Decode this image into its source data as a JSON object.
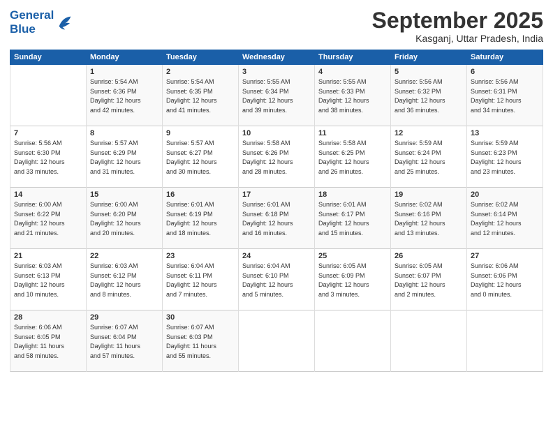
{
  "logo": {
    "line1": "General",
    "line2": "Blue"
  },
  "title": "September 2025",
  "subtitle": "Kasganj, Uttar Pradesh, India",
  "headers": [
    "Sunday",
    "Monday",
    "Tuesday",
    "Wednesday",
    "Thursday",
    "Friday",
    "Saturday"
  ],
  "weeks": [
    [
      {
        "day": "",
        "info": ""
      },
      {
        "day": "1",
        "info": "Sunrise: 5:54 AM\nSunset: 6:36 PM\nDaylight: 12 hours\nand 42 minutes."
      },
      {
        "day": "2",
        "info": "Sunrise: 5:54 AM\nSunset: 6:35 PM\nDaylight: 12 hours\nand 41 minutes."
      },
      {
        "day": "3",
        "info": "Sunrise: 5:55 AM\nSunset: 6:34 PM\nDaylight: 12 hours\nand 39 minutes."
      },
      {
        "day": "4",
        "info": "Sunrise: 5:55 AM\nSunset: 6:33 PM\nDaylight: 12 hours\nand 38 minutes."
      },
      {
        "day": "5",
        "info": "Sunrise: 5:56 AM\nSunset: 6:32 PM\nDaylight: 12 hours\nand 36 minutes."
      },
      {
        "day": "6",
        "info": "Sunrise: 5:56 AM\nSunset: 6:31 PM\nDaylight: 12 hours\nand 34 minutes."
      }
    ],
    [
      {
        "day": "7",
        "info": "Sunrise: 5:56 AM\nSunset: 6:30 PM\nDaylight: 12 hours\nand 33 minutes."
      },
      {
        "day": "8",
        "info": "Sunrise: 5:57 AM\nSunset: 6:29 PM\nDaylight: 12 hours\nand 31 minutes."
      },
      {
        "day": "9",
        "info": "Sunrise: 5:57 AM\nSunset: 6:27 PM\nDaylight: 12 hours\nand 30 minutes."
      },
      {
        "day": "10",
        "info": "Sunrise: 5:58 AM\nSunset: 6:26 PM\nDaylight: 12 hours\nand 28 minutes."
      },
      {
        "day": "11",
        "info": "Sunrise: 5:58 AM\nSunset: 6:25 PM\nDaylight: 12 hours\nand 26 minutes."
      },
      {
        "day": "12",
        "info": "Sunrise: 5:59 AM\nSunset: 6:24 PM\nDaylight: 12 hours\nand 25 minutes."
      },
      {
        "day": "13",
        "info": "Sunrise: 5:59 AM\nSunset: 6:23 PM\nDaylight: 12 hours\nand 23 minutes."
      }
    ],
    [
      {
        "day": "14",
        "info": "Sunrise: 6:00 AM\nSunset: 6:22 PM\nDaylight: 12 hours\nand 21 minutes."
      },
      {
        "day": "15",
        "info": "Sunrise: 6:00 AM\nSunset: 6:20 PM\nDaylight: 12 hours\nand 20 minutes."
      },
      {
        "day": "16",
        "info": "Sunrise: 6:01 AM\nSunset: 6:19 PM\nDaylight: 12 hours\nand 18 minutes."
      },
      {
        "day": "17",
        "info": "Sunrise: 6:01 AM\nSunset: 6:18 PM\nDaylight: 12 hours\nand 16 minutes."
      },
      {
        "day": "18",
        "info": "Sunrise: 6:01 AM\nSunset: 6:17 PM\nDaylight: 12 hours\nand 15 minutes."
      },
      {
        "day": "19",
        "info": "Sunrise: 6:02 AM\nSunset: 6:16 PM\nDaylight: 12 hours\nand 13 minutes."
      },
      {
        "day": "20",
        "info": "Sunrise: 6:02 AM\nSunset: 6:14 PM\nDaylight: 12 hours\nand 12 minutes."
      }
    ],
    [
      {
        "day": "21",
        "info": "Sunrise: 6:03 AM\nSunset: 6:13 PM\nDaylight: 12 hours\nand 10 minutes."
      },
      {
        "day": "22",
        "info": "Sunrise: 6:03 AM\nSunset: 6:12 PM\nDaylight: 12 hours\nand 8 minutes."
      },
      {
        "day": "23",
        "info": "Sunrise: 6:04 AM\nSunset: 6:11 PM\nDaylight: 12 hours\nand 7 minutes."
      },
      {
        "day": "24",
        "info": "Sunrise: 6:04 AM\nSunset: 6:10 PM\nDaylight: 12 hours\nand 5 minutes."
      },
      {
        "day": "25",
        "info": "Sunrise: 6:05 AM\nSunset: 6:09 PM\nDaylight: 12 hours\nand 3 minutes."
      },
      {
        "day": "26",
        "info": "Sunrise: 6:05 AM\nSunset: 6:07 PM\nDaylight: 12 hours\nand 2 minutes."
      },
      {
        "day": "27",
        "info": "Sunrise: 6:06 AM\nSunset: 6:06 PM\nDaylight: 12 hours\nand 0 minutes."
      }
    ],
    [
      {
        "day": "28",
        "info": "Sunrise: 6:06 AM\nSunset: 6:05 PM\nDaylight: 11 hours\nand 58 minutes."
      },
      {
        "day": "29",
        "info": "Sunrise: 6:07 AM\nSunset: 6:04 PM\nDaylight: 11 hours\nand 57 minutes."
      },
      {
        "day": "30",
        "info": "Sunrise: 6:07 AM\nSunset: 6:03 PM\nDaylight: 11 hours\nand 55 minutes."
      },
      {
        "day": "",
        "info": ""
      },
      {
        "day": "",
        "info": ""
      },
      {
        "day": "",
        "info": ""
      },
      {
        "day": "",
        "info": ""
      }
    ]
  ]
}
